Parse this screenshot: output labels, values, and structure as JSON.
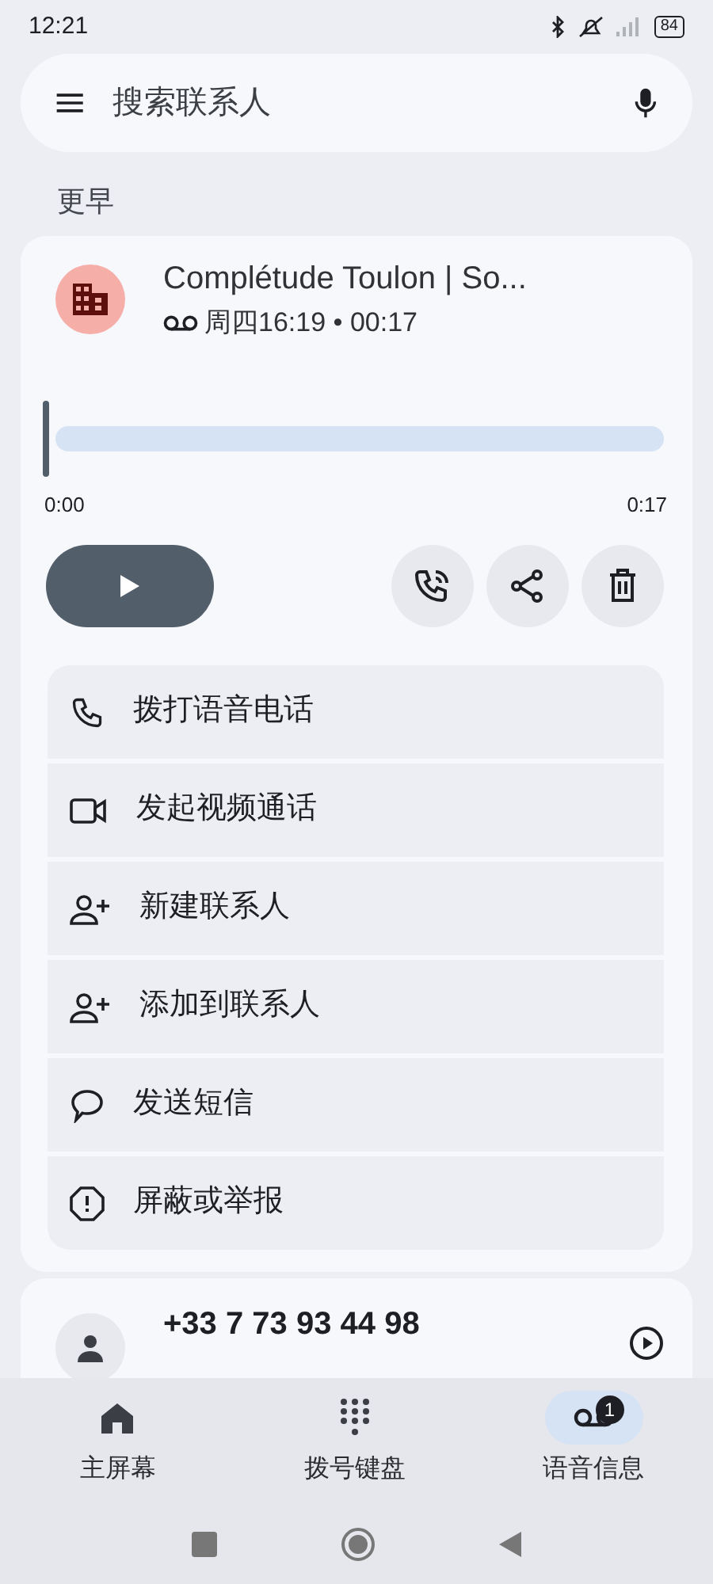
{
  "status_bar": {
    "time": "12:21",
    "battery": "84"
  },
  "search": {
    "placeholder": "搜索联系人"
  },
  "section_header": "更早",
  "expanded_entry": {
    "name": "Complétude Toulon | So...",
    "detail": "周四16:19 • 00:17",
    "playback": {
      "level": 0,
      "start": "0:00",
      "end": "0:17",
      "playing": false
    },
    "actions": [
      {
        "kind": "phone",
        "label": "拨打语音电话"
      },
      {
        "kind": "video",
        "label": "发起视频通话"
      },
      {
        "kind": "person-add",
        "label": "新建联系人"
      },
      {
        "kind": "person-add",
        "label": "添加到联系人"
      },
      {
        "kind": "message",
        "label": "发送短信"
      },
      {
        "kind": "alert",
        "label": "屏蔽或举报"
      }
    ]
  },
  "next_entry": {
    "name": "+33 7 73 93 44 98"
  },
  "bottom_nav": [
    {
      "kind": "home",
      "label": "主屏幕",
      "selected": false
    },
    {
      "kind": "dialpad",
      "label": "拨号键盘",
      "selected": false
    },
    {
      "kind": "voicemail",
      "label": "语音信息",
      "selected": true,
      "badge": "1"
    }
  ]
}
